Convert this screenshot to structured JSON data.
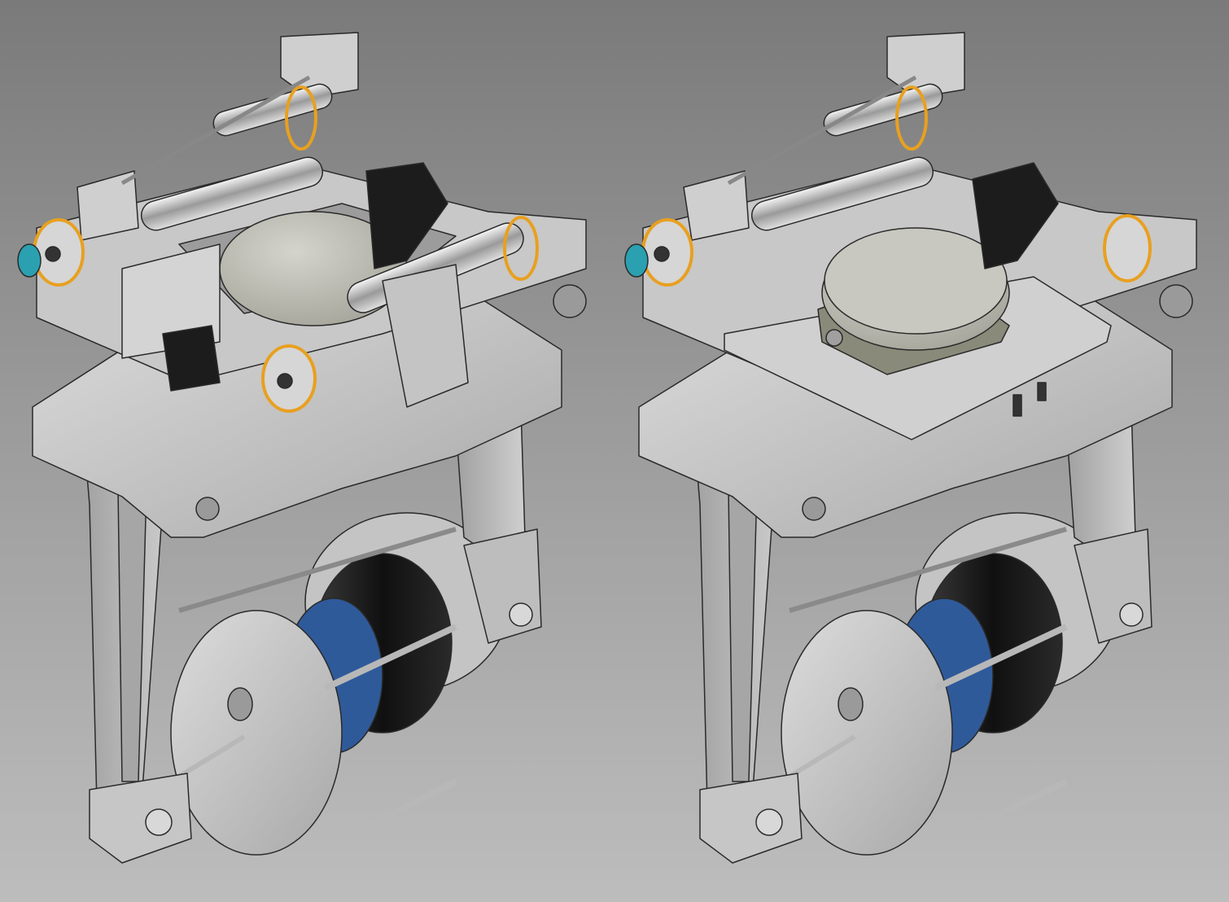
{
  "scene": {
    "background_top": "#7a7a7a",
    "background_bottom": "#bdbdbd",
    "models": [
      {
        "id": "left",
        "variant": "frame-open",
        "description_visible_text": ""
      },
      {
        "id": "right",
        "variant": "plate-mounted",
        "description_visible_text": ""
      }
    ]
  },
  "colors": {
    "metal_light": "#d2d2d2",
    "metal_mid": "#b4b4b4",
    "metal_dark": "#8e8e8e",
    "edge": "#2a2a2a",
    "bearing_ring": "#e8a020",
    "blue_part": "#2f5a9a",
    "black_part": "#1c1c1c",
    "teal_knob": "#2aa0b0",
    "disc_top": "#bfbfb5"
  }
}
